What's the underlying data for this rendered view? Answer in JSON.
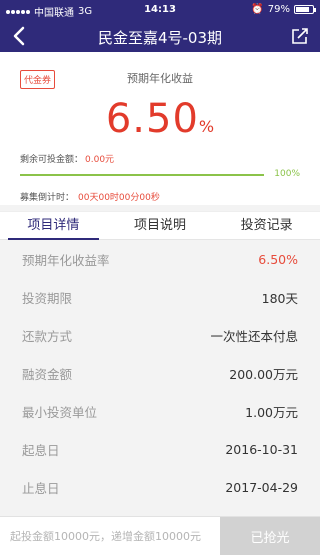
{
  "status_bar": {
    "carrier": "中国联通",
    "network": "3G",
    "time": "14:13",
    "battery": "79%",
    "battery_level": 0.79
  },
  "nav": {
    "title": "民金至嘉4号-03期",
    "back_icon": "chevron-left-icon",
    "share_icon": "share-icon"
  },
  "summary": {
    "coupon_badge": "代金券",
    "rate_label": "预期年化收益",
    "rate_value": "6.50",
    "rate_unit": "%",
    "remaining_label": "剩余可投金额：",
    "remaining_value": "0.00元",
    "progress_percent": "100%",
    "progress_fraction": 1.0,
    "countdown_label": "募集倒计时：",
    "countdown_value": "00天00时00分00秒"
  },
  "tabs": [
    {
      "label": "项目详情",
      "active": true
    },
    {
      "label": "项目说明",
      "active": false
    },
    {
      "label": "投资记录",
      "active": false
    }
  ],
  "details": [
    {
      "key": "预期年化收益率",
      "value": "6.50%"
    },
    {
      "key": "投资期限",
      "value": "180天"
    },
    {
      "key": "还款方式",
      "value": "一次性还本付息"
    },
    {
      "key": "融资金额",
      "value": "200.00万元"
    },
    {
      "key": "最小投资单位",
      "value": "1.00万元"
    },
    {
      "key": "起息日",
      "value": "2016-10-31"
    },
    {
      "key": "止息日",
      "value": "2017-04-29"
    }
  ],
  "bottom": {
    "input_placeholder": "起投金额10000元，递增金额10000元",
    "button_label": "已抢光"
  },
  "colors": {
    "brand": "#2f2a7a",
    "accent_red": "#e23b2b",
    "progress_green": "#8bc34a",
    "disabled_button": "#d2d2d2"
  }
}
